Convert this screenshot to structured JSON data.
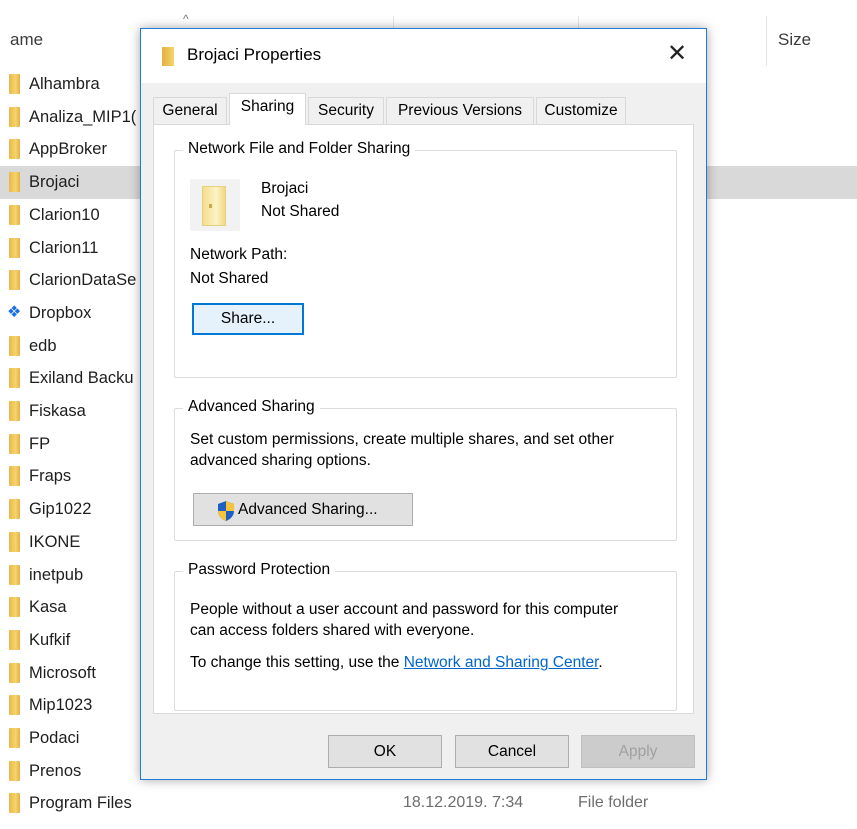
{
  "explorer": {
    "columns": {
      "name": "ame",
      "size": "Size"
    },
    "files": [
      {
        "name": "Alhambra",
        "icon": "folder-icon"
      },
      {
        "name": "Analiza_MIP1(",
        "icon": "folder-icon"
      },
      {
        "name": "AppBroker",
        "icon": "folder-icon"
      },
      {
        "name": "Brojaci",
        "icon": "folder-icon",
        "selected": true
      },
      {
        "name": "Clarion10",
        "icon": "folder-icon"
      },
      {
        "name": "Clarion11",
        "icon": "folder-icon"
      },
      {
        "name": "ClarionDataSe",
        "icon": "folder-icon"
      },
      {
        "name": "Dropbox",
        "icon": "dropbox-icon"
      },
      {
        "name": "edb",
        "icon": "folder-icon"
      },
      {
        "name": "Exiland Backu",
        "icon": "folder-icon"
      },
      {
        "name": "Fiskasa",
        "icon": "folder-icon"
      },
      {
        "name": "FP",
        "icon": "folder-icon"
      },
      {
        "name": "Fraps",
        "icon": "folder-icon"
      },
      {
        "name": "Gip1022",
        "icon": "folder-icon"
      },
      {
        "name": "IKONE",
        "icon": "folder-icon"
      },
      {
        "name": "inetpub",
        "icon": "folder-icon"
      },
      {
        "name": "Kasa",
        "icon": "folder-icon"
      },
      {
        "name": "Kufkif",
        "icon": "folder-icon"
      },
      {
        "name": "Microsoft",
        "icon": "folder-icon"
      },
      {
        "name": "Mip1023",
        "icon": "folder-icon"
      },
      {
        "name": "Podaci",
        "icon": "folder-icon"
      },
      {
        "name": "Prenos",
        "icon": "folder-icon"
      },
      {
        "name": "Program Files",
        "icon": "folder-icon",
        "date": "18.12.2019. 7:34",
        "type": "File folder"
      }
    ]
  },
  "dialog": {
    "title": "Brojaci Properties",
    "close_symbol": "✕",
    "tabs": [
      "General",
      "Sharing",
      "Security",
      "Previous Versions",
      "Customize"
    ],
    "active_tab": "Sharing",
    "network_sharing": {
      "legend": "Network File and Folder Sharing",
      "folder_name": "Brojaci",
      "folder_status": "Not Shared",
      "path_label": "Network Path:",
      "path_value": "Not Shared",
      "share_button": "Share..."
    },
    "advanced_sharing": {
      "legend": "Advanced Sharing",
      "description_line1": "Set custom permissions, create multiple shares, and set other",
      "description_line2": "advanced sharing options.",
      "button": "Advanced Sharing..."
    },
    "password_protection": {
      "legend": "Password Protection",
      "line1": "People without a user account and password for this computer",
      "line2": "can access folders shared with everyone.",
      "change_prefix": "To change this setting, use the ",
      "link": "Network and Sharing Center",
      "change_suffix": "."
    },
    "buttons": {
      "ok": "OK",
      "cancel": "Cancel",
      "apply": "Apply"
    }
  },
  "colors": {
    "accent": "#0078d7",
    "dialog_border": "#1f7ad8",
    "link": "#0066cc",
    "folder": "#f6d46b"
  }
}
